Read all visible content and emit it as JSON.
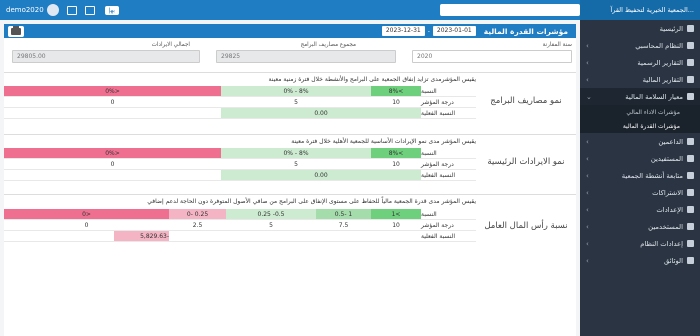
{
  "topbar": {
    "username": "demo2020",
    "badge": "ﺑﻬﺈ",
    "brand": "الجمعية الخيرية لتحفيظ القرآ..."
  },
  "sidebar": {
    "items": [
      {
        "label": "الرئيسية"
      },
      {
        "label": "النظام المحاسبي"
      },
      {
        "label": "التقارير الرسمية"
      },
      {
        "label": "التقارير المالية"
      },
      {
        "label": "معيار السلامة المالية",
        "active": true
      },
      {
        "label": "الداعمين"
      },
      {
        "label": "المستفيدين"
      },
      {
        "label": "متابعة أنشطة الجمعية"
      },
      {
        "label": "الاشتراكات"
      },
      {
        "label": "الإعدادات"
      },
      {
        "label": "المستخدمين"
      },
      {
        "label": "إعدادات النظام"
      },
      {
        "label": "الوثائق"
      }
    ],
    "submenu": [
      {
        "label": "مؤشرات الاداء المالي"
      },
      {
        "label": "مؤشرات القدرة المالية"
      }
    ]
  },
  "header": {
    "title": "مؤشرات القدرة المالية",
    "date_from": "2023-01-01",
    "date_to": "2023-12-31",
    "date_separator": "-"
  },
  "filters": {
    "fiscal_year_label": "سنة المقارنة",
    "fiscal_year_value": "2020",
    "expenses_label": "مجموع مصاريف البرامج",
    "expenses_value": "29825",
    "revenues_label": "اجمالي الايرادات",
    "revenues_value": "29805.00"
  },
  "indicators": [
    {
      "name": "نمو مصاريف البرامج",
      "description": "يقيس المؤشرمدى تزايد إنفاق الجمعية على البرامج والأنشطة خلال فترة زمنية معينة",
      "ratio_label": "النسبة",
      "score_label": "درجة المؤشر",
      "actual_label": "النسبة الفعلية",
      "ratios": [
        ">8%",
        "8% - 0%",
        "<0%"
      ],
      "scores": [
        "10",
        "5",
        "0"
      ],
      "actual": "0.00"
    },
    {
      "name": "نمو الايرادات الرئيسية",
      "description": "يقيس المؤشر مدى نمو الإيرادات الأساسية للجمعية الأهلية خلال فترة معينة",
      "ratio_label": "النسبة",
      "score_label": "درجة المؤشر",
      "actual_label": "النسبة الفعلية",
      "ratios": [
        ">8%",
        "8% - 0%",
        "<0%"
      ],
      "scores": [
        "10",
        "5",
        "0"
      ],
      "actual": "0.00"
    },
    {
      "name": "نسبة رأس المال العامل",
      "description": "يقيس المؤشر مدى قدرة الجمعية مالياً للحفاظ على مستوى الإنفاق على البرامج من صافي الأصول المتوفرة دون الحاجة لدعم إضافي",
      "ratio_label": "النسبة",
      "score_label": "درجة المؤشر",
      "actual_label": "النسبة الفعلية",
      "ratios": [
        ">1",
        "1 -0.5",
        "0.5- 0.25",
        "0.25 -0",
        "<0"
      ],
      "scores": [
        "10",
        "7.5",
        "5",
        "2.5",
        "0"
      ],
      "actual": "-5,829.63"
    }
  ],
  "colors": {
    "primary": "#1f7dc4",
    "sidebar": "#2a3442",
    "green_high": "#6ed07c",
    "green_low": "#cdebd1",
    "red": "#ee6f8f"
  }
}
